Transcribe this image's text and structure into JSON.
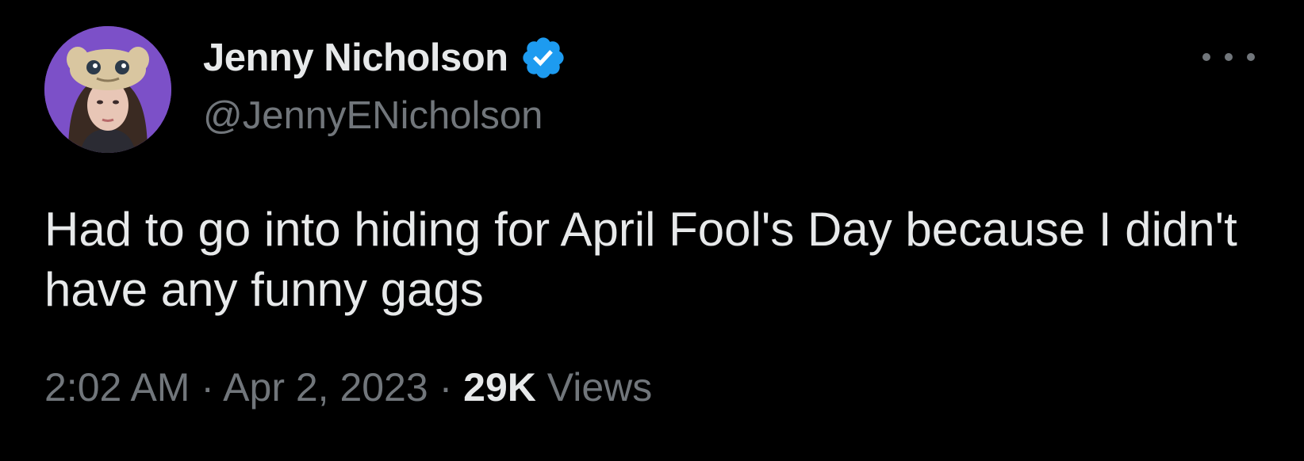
{
  "tweet": {
    "author": {
      "display_name": "Jenny Nicholson",
      "handle": "@JennyENicholson",
      "verified": true,
      "verified_color": "#1d9bf0"
    },
    "text": "Had to go into hiding for April Fool's Day because I didn't have any funny gags",
    "time": "2:02 AM",
    "separator": "·",
    "date": "Apr 2, 2023",
    "views_count": "29K",
    "views_label": "Views",
    "more_icon": "more-horizontal-icon"
  },
  "theme": {
    "background": "#000000",
    "text_primary": "#e7e9ea",
    "text_secondary": "#71767b"
  }
}
